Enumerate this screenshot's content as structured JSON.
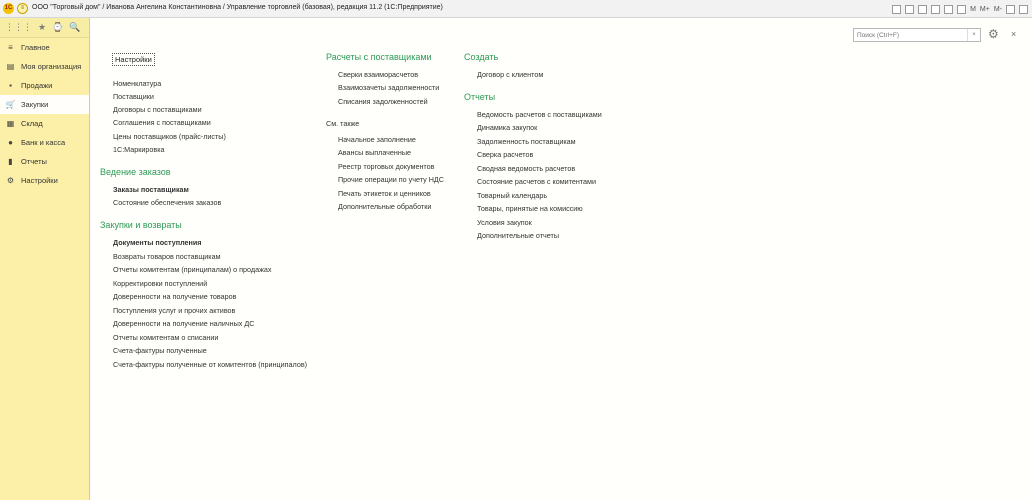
{
  "window": {
    "logo_text": "1С",
    "menu_glyph": "≡",
    "title": "ООО \"Торговый дом\" / Иванова Ангелина Константиновна / Управление торговлей (базовая), редакция 11.2  (1С:Предприятие)",
    "right_icons": [
      "save-icon",
      "print-icon",
      "calculator-icon",
      "history-icon",
      "table-icon",
      "list-icon"
    ],
    "right_labels": [
      "M",
      "M+",
      "M-"
    ]
  },
  "sidebar": {
    "tools": [
      "⋮⋮⋮",
      "★",
      "⌚",
      "🔍"
    ],
    "items": [
      {
        "label": "Главное",
        "icon": "≡"
      },
      {
        "label": "Моя организация",
        "icon": "▤"
      },
      {
        "label": "Продажи",
        "icon": "▪"
      },
      {
        "label": "Закупки",
        "icon": "🛒"
      },
      {
        "label": "Склад",
        "icon": "▦"
      },
      {
        "label": "Банк и касса",
        "icon": "●"
      },
      {
        "label": "Отчеты",
        "icon": "▮"
      },
      {
        "label": "Настройки",
        "icon": "⚙"
      }
    ],
    "active_index": 3
  },
  "search": {
    "placeholder": "Поиск (Ctrl+F)",
    "clear": "×"
  },
  "gear": "⚙",
  "close": "×",
  "col1": {
    "settings": "Настройки",
    "links1": [
      "Номенклатура",
      "Поставщики",
      "Договоры с поставщиками",
      "Соглашения с поставщиками",
      "Цены поставщиков (прайс-листы)",
      "1С:Маркировка"
    ],
    "orders_title": "Ведение заказов",
    "orders": [
      "Заказы поставщикам",
      "Состояние обеспечения заказов"
    ],
    "purchases_title": "Закупки и возвраты",
    "purchases": [
      "Документы поступления",
      "Возвраты товаров поставщикам",
      "Отчеты комитентам (принципалам) о продажах",
      "Корректировки поступлений",
      "Доверенности на получение товаров",
      "Поступления услуг и прочих активов",
      "Доверенности на получение наличных ДС",
      "Отчеты комитентам о списании",
      "Счета-фактуры полученные",
      "Счета-фактуры полученные от комитентов (принципалов)"
    ]
  },
  "col2": {
    "settlements_title": "Расчеты с поставщиками",
    "settlements": [
      "Сверки взаиморасчетов",
      "Взаимозачеты задолженности",
      "Списания задолженностей"
    ],
    "see_also": "См. также",
    "see_also_links": [
      "Начальное заполнение",
      "Авансы выплаченные",
      "Реестр торговых документов",
      "Прочие операции по учету НДС",
      "Печать этикеток и ценников",
      "Дополнительные обработки"
    ]
  },
  "col3": {
    "create_title": "Создать",
    "create": [
      "Договор с клиентом"
    ],
    "reports_title": "Отчеты",
    "reports": [
      "Ведомость расчетов с поставщиками",
      "Динамика закупок",
      "Задолженность поставщикам",
      "Сверка расчетов",
      "Сводная ведомость расчетов",
      "Состояние расчетов с комитентами",
      "Товарный календарь",
      "Товары, принятые на комиссию",
      "Условия закупок",
      "Дополнительные отчеты"
    ]
  }
}
